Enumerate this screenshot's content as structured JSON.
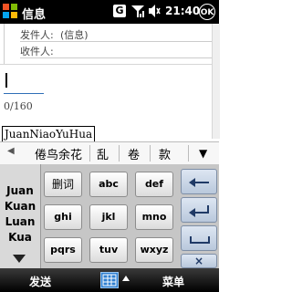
{
  "status_bar": {
    "title": "信息",
    "network_badge": "G",
    "time": "21:40",
    "ok_label": "OK",
    "icons": [
      "windows-flag-icon",
      "signal-icon",
      "volume-icon"
    ]
  },
  "header": {
    "from_label": "发件人:",
    "from_value": "(信息)",
    "to_label": "收件人:",
    "to_value": ""
  },
  "body": {
    "char_counter": "0/160"
  },
  "ime": {
    "composition": "JuanNiaoYuHua",
    "candidates": [
      "倦鸟余花",
      "乱",
      "卷",
      "款"
    ],
    "pinyin_options": [
      "Juan",
      "Kuan",
      "Luan",
      "Kua"
    ],
    "keys": {
      "row1": [
        "删词",
        "abc",
        "def"
      ],
      "row2": [
        "ghi",
        "jkl",
        "mno"
      ],
      "row3": [
        "pqrs",
        "tuv",
        "wxyz"
      ]
    },
    "close_label": "×"
  },
  "softkeys": {
    "left": "发送",
    "right": "菜单"
  }
}
